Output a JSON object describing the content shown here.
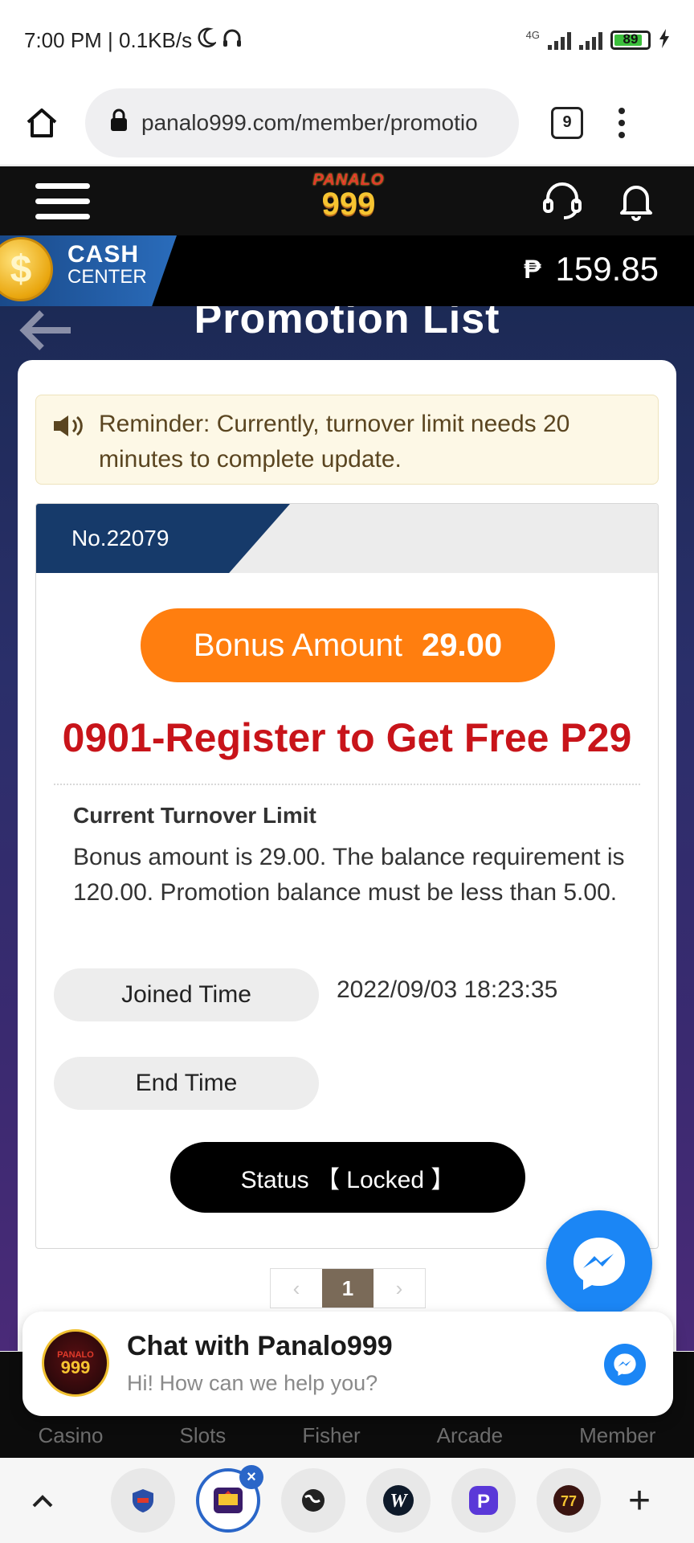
{
  "status_bar": {
    "time_speed": "7:00 PM | 0.1KB/s",
    "network": "4G",
    "battery": "89"
  },
  "browser": {
    "url": "panalo999.com/member/promotio",
    "tab_count": "9"
  },
  "site_header": {
    "logo_top": "PANALO",
    "logo_num": "999"
  },
  "cash_center": {
    "line1": "CASH",
    "line2": "CENTER",
    "currency": "₱",
    "balance": "159.85"
  },
  "page": {
    "title": "Promotion List"
  },
  "reminder": {
    "text": "Reminder: Currently, turnover limit needs 20 minutes to complete update."
  },
  "promotion": {
    "number": "No.22079",
    "bonus_label": "Bonus Amount",
    "bonus_amount": "29.00",
    "title": "0901-Register to Get Free P29",
    "turnover_heading": "Current Turnover Limit",
    "turnover_text": "Bonus amount is 29.00. The balance requirement is 120.00. Promotion balance must be less than 5.00.",
    "joined_label": "Joined Time",
    "joined_value": "2022/09/03 18:23:35",
    "end_label": "End Time",
    "status": "Status 【 Locked 】"
  },
  "pagination": {
    "prev": "‹",
    "current": "1",
    "next": "›"
  },
  "chat": {
    "title": "Chat with Panalo999",
    "subtitle": "Hi! How can we help you?",
    "avatar_top": "PANALO",
    "avatar_num": "999"
  },
  "bottom_nav": {
    "items": [
      "Casino",
      "Slots",
      "Fisher",
      "Arcade",
      "Member"
    ]
  },
  "dock": {
    "apps": [
      "shield-app",
      "panalo-app",
      "globe-app",
      "w-app",
      "p-app",
      "lucky-app"
    ],
    "active_app": "panalo-app"
  },
  "colors": {
    "accent_orange": "#ff7e0f",
    "title_red": "#c8141a",
    "navy": "#163a6a",
    "messenger_blue": "#1b86f5"
  }
}
